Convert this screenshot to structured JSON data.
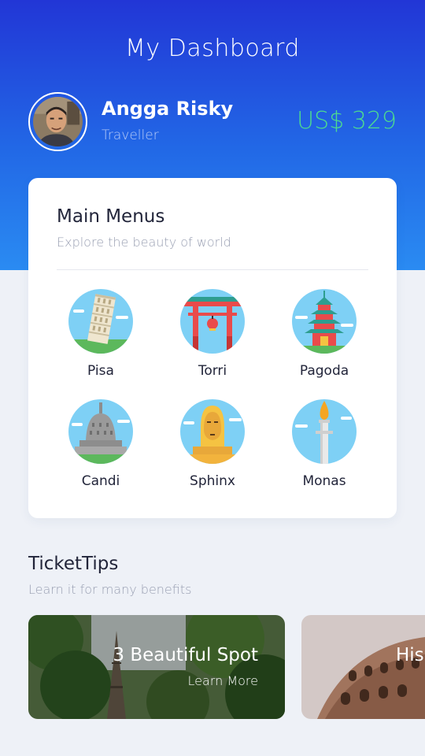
{
  "header": {
    "title": "My Dashboard",
    "background_color_top": "#2236d6",
    "background_color_bottom": "#2a8bf2"
  },
  "profile": {
    "name": "Angga Risky",
    "role": "Traveller",
    "balance": "US$ 329",
    "balance_color": "#4ddb8f"
  },
  "main_menu": {
    "title": "Main Menus",
    "subtitle": "Explore the beauty of world",
    "items": [
      {
        "label": "Pisa",
        "icon": "leaning-tower-icon"
      },
      {
        "label": "Torri",
        "icon": "torii-gate-icon"
      },
      {
        "label": "Pagoda",
        "icon": "pagoda-icon"
      },
      {
        "label": "Candi",
        "icon": "temple-stupa-icon"
      },
      {
        "label": "Sphinx",
        "icon": "sphinx-icon"
      },
      {
        "label": "Monas",
        "icon": "monument-icon"
      }
    ]
  },
  "ticket_tips": {
    "title": "TicketTips",
    "subtitle": "Learn it for many benefits",
    "cards": [
      {
        "title": "3 Beautiful Spot",
        "link": "Learn More",
        "image": "eiffel-tower-photo"
      },
      {
        "title": "His",
        "link": "",
        "image": "colosseum-photo"
      }
    ]
  }
}
